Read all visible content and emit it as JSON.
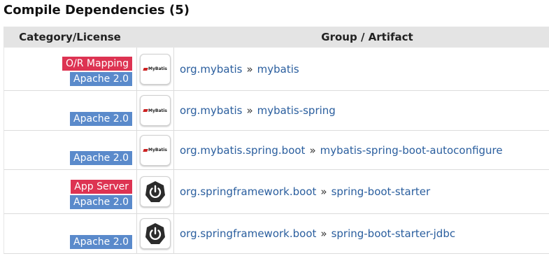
{
  "heading": "Compile Dependencies (5)",
  "columns": {
    "category": "Category/License",
    "artifact": "Group / Artifact"
  },
  "separator": "»",
  "rows": [
    {
      "category": "O/R Mapping",
      "license": "Apache 2.0",
      "logo": "mybatis-logo",
      "logo_text": "MyBatis",
      "group": "org.mybatis",
      "artifact": "mybatis"
    },
    {
      "category": "",
      "license": "Apache 2.0",
      "logo": "mybatis-logo",
      "logo_text": "MyBatis",
      "group": "org.mybatis",
      "artifact": "mybatis-spring"
    },
    {
      "category": "",
      "license": "Apache 2.0",
      "logo": "mybatis-logo",
      "logo_text": "MyBatis",
      "group": "org.mybatis.spring.boot",
      "artifact": "mybatis-spring-boot-autoconfigure"
    },
    {
      "category": "App Server",
      "license": "Apache 2.0",
      "logo": "spring-boot-power-logo",
      "logo_text": "",
      "group": "org.springframework.boot",
      "artifact": "spring-boot-starter"
    },
    {
      "category": "",
      "license": "Apache 2.0",
      "logo": "spring-boot-power-logo",
      "logo_text": "",
      "group": "org.springframework.boot",
      "artifact": "spring-boot-starter-jdbc"
    }
  ],
  "colors": {
    "category_badge": "#dd3352",
    "license_badge": "#5a8acb",
    "link": "#2a5e9e",
    "header_bg": "#e4e4e4"
  }
}
